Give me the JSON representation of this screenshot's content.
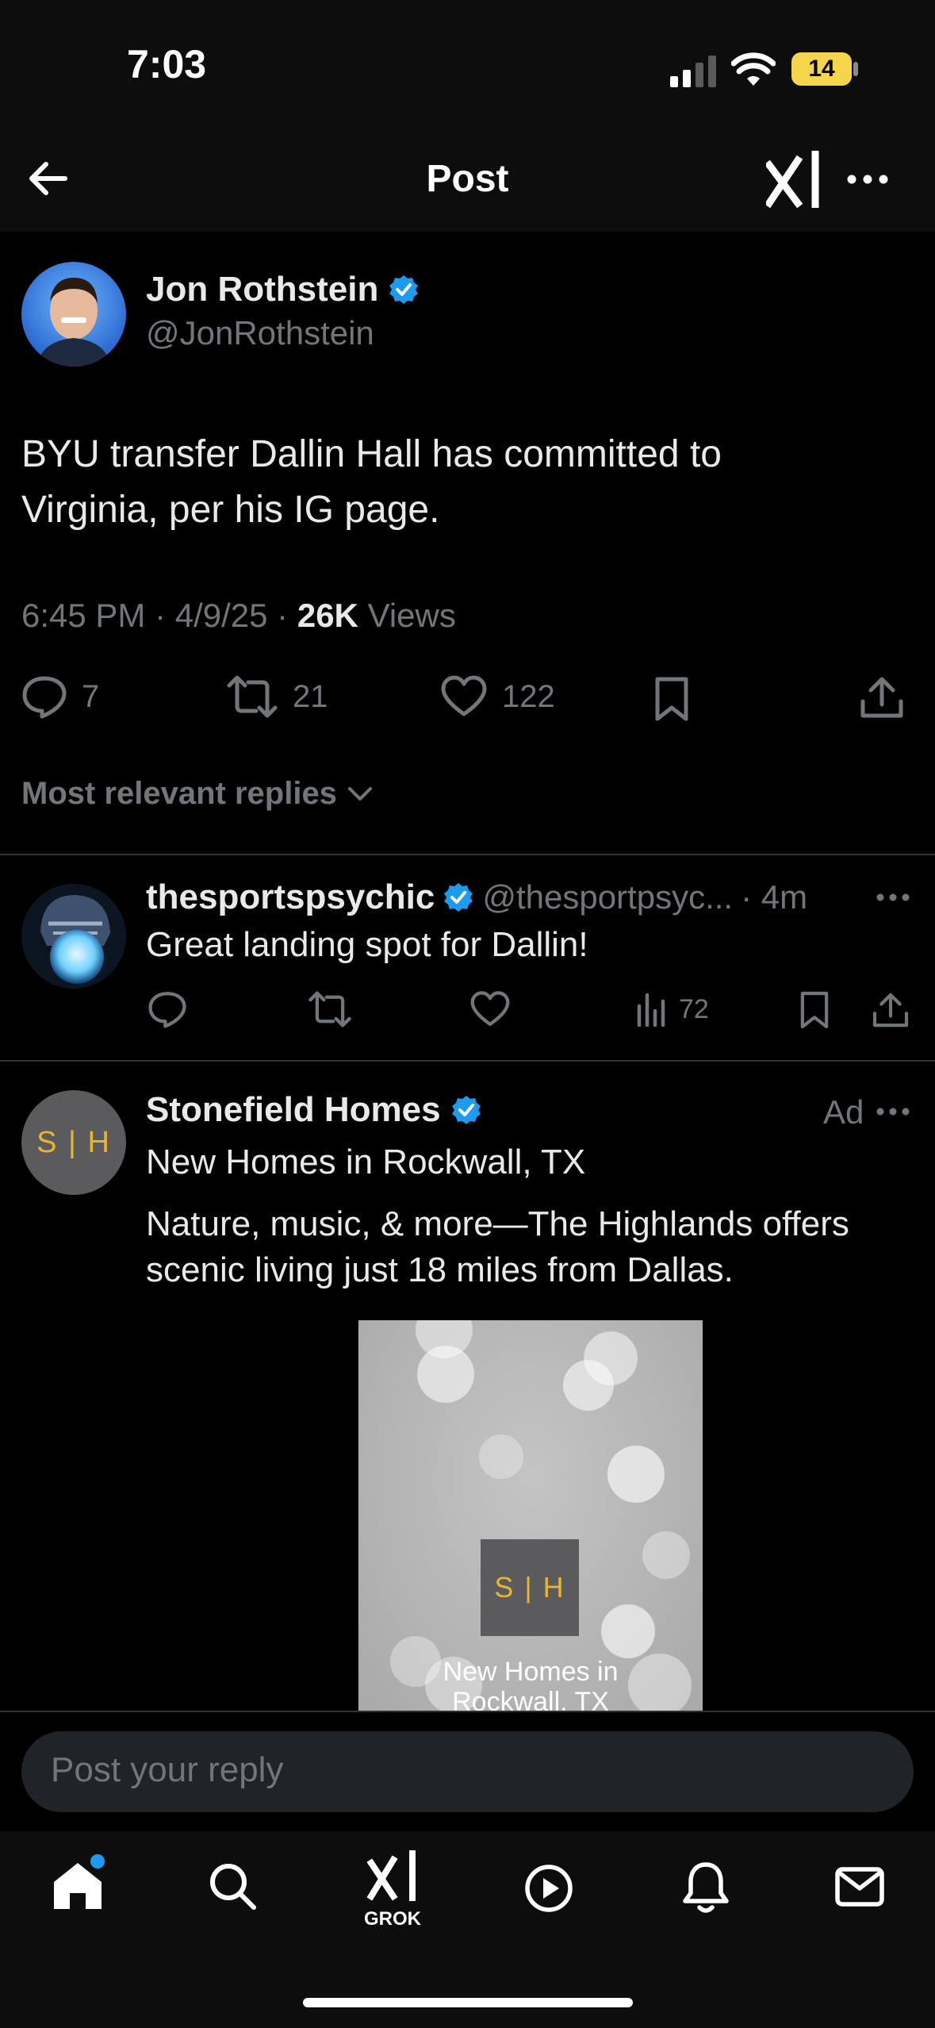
{
  "status_bar": {
    "time": "7:03",
    "battery": "14"
  },
  "header": {
    "title": "Post"
  },
  "post": {
    "author_name": "Jon Rothstein",
    "author_handle": "@JonRothstein",
    "text_line1": "BYU transfer Dallin Hall has committed to",
    "text_line2": "Virginia, per his IG page.",
    "timestamp": "6:45 PM · 4/9/25 · ",
    "views_count": "26K",
    "views_label": " Views",
    "replies": "7",
    "reposts": "21",
    "likes": "122"
  },
  "replies_sort": {
    "label": "Most relevant replies"
  },
  "reply": {
    "author_name": "thesportspsychic",
    "author_handle": "@thesportpsyc...",
    "time": " · 4m",
    "text": "Great landing spot for Dallin!",
    "views": "72"
  },
  "ad": {
    "author_name": "Stonefield Homes",
    "ad_label": "Ad",
    "headline": "New Homes in Rockwall, TX",
    "body_line1": "Nature, music, & more—The Highlands offers",
    "body_line2": "scenic living just 18 miles from Dallas.",
    "logo_text": "S | H",
    "image_caption_line1": "New Homes in",
    "image_caption_line2": "Rockwall, TX"
  },
  "compose": {
    "placeholder": "Post your reply"
  },
  "tabbar": {
    "grok_label": "GROK"
  },
  "colors": {
    "verified": "#1d9bf0",
    "accent_gold": "#e8b530",
    "notification_dot": "#1d9bf0"
  }
}
